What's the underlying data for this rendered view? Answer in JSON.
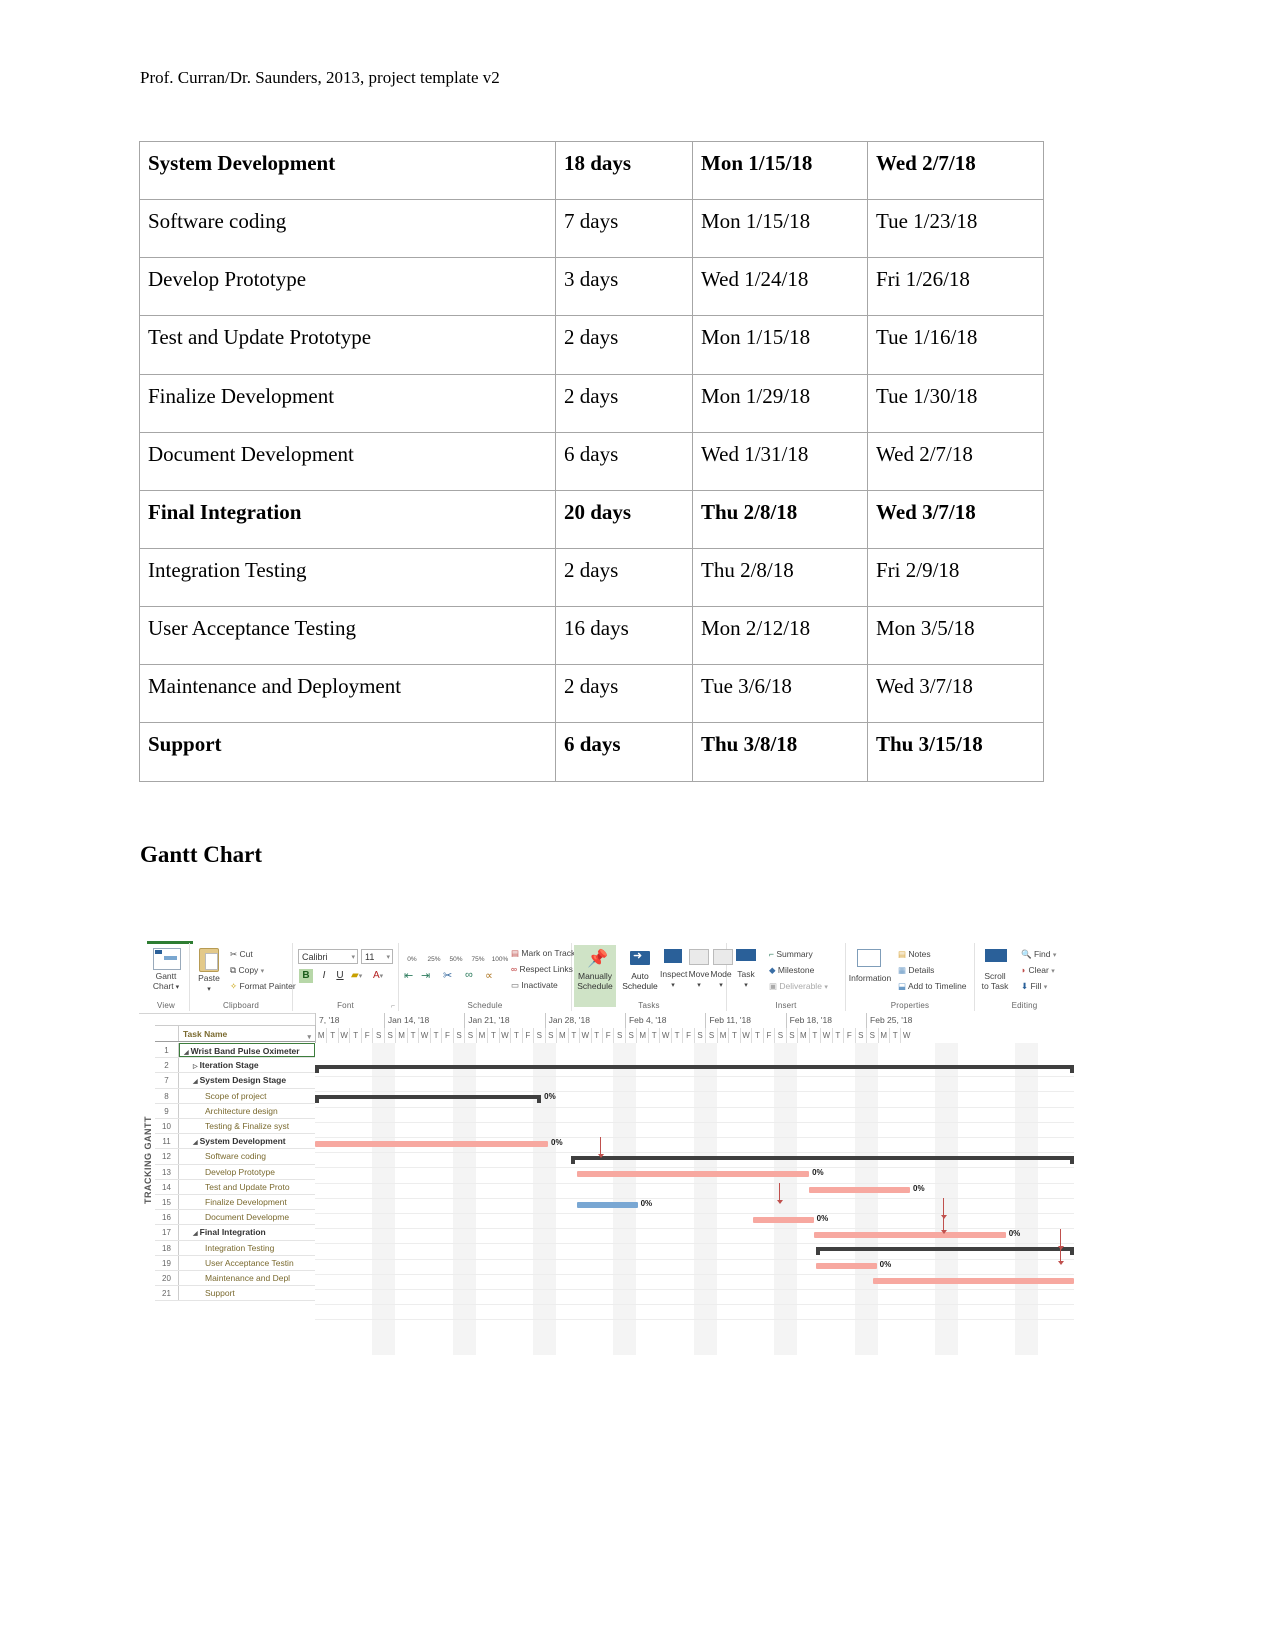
{
  "document": {
    "header_note": "Prof. Curran/Dr. Saunders, 2013, project template v2",
    "gantt_heading": "Gantt Chart"
  },
  "schedule_table": {
    "columns": [
      "Task Name",
      "Duration",
      "Start",
      "Finish"
    ],
    "rows": [
      {
        "name": "System Development",
        "duration": "18 days",
        "start": "Mon 1/15/18",
        "finish": "Wed 2/7/18",
        "level": "summary"
      },
      {
        "name": "Software coding",
        "duration": "7 days",
        "start": "Mon 1/15/18",
        "finish": "Tue 1/23/18",
        "level": "task"
      },
      {
        "name": "Develop Prototype",
        "duration": "3 days",
        "start": "Wed 1/24/18",
        "finish": "Fri 1/26/18",
        "level": "task"
      },
      {
        "name": "Test and Update Prototype",
        "duration": "2 days",
        "start": "Mon 1/15/18",
        "finish": "Tue 1/16/18",
        "level": "task"
      },
      {
        "name": "Finalize Development",
        "duration": "2 days",
        "start": "Mon 1/29/18",
        "finish": "Tue 1/30/18",
        "level": "task"
      },
      {
        "name": "Document Development",
        "duration": "6 days",
        "start": "Wed 1/31/18",
        "finish": "Wed 2/7/18",
        "level": "task"
      },
      {
        "name": "Final Integration",
        "duration": "20 days",
        "start": "Thu 2/8/18",
        "finish": "Wed 3/7/18",
        "level": "summary"
      },
      {
        "name": "Integration Testing",
        "duration": "2 days",
        "start": "Thu 2/8/18",
        "finish": "Fri 2/9/18",
        "level": "task"
      },
      {
        "name": "User Acceptance Testing",
        "duration": "16 days",
        "start": "Mon 2/12/18",
        "finish": "Mon 3/5/18",
        "level": "task"
      },
      {
        "name": "Maintenance and Deployment",
        "duration": "2 days",
        "start": "Tue 3/6/18",
        "finish": "Wed 3/7/18",
        "level": "task"
      },
      {
        "name": "Support",
        "duration": "6 days",
        "start": "Thu 3/8/18",
        "finish": "Thu 3/15/18",
        "level": "summary"
      }
    ]
  },
  "msproject": {
    "ribbon": {
      "groups": [
        {
          "label": "View",
          "items": [
            "Gantt Chart"
          ]
        },
        {
          "label": "Clipboard",
          "items": [
            "Paste",
            "Cut",
            "Copy",
            "Format Painter"
          ]
        },
        {
          "label": "Font",
          "items": [
            "Calibri",
            "11",
            "B",
            "I",
            "U"
          ]
        },
        {
          "label": "Schedule",
          "items": [
            "0%",
            "25%",
            "50%",
            "75%",
            "100%",
            "Mark on Track",
            "Respect Links",
            "Inactivate"
          ]
        },
        {
          "label": "Tasks",
          "items": [
            "Manually Schedule",
            "Auto Schedule",
            "Inspect",
            "Move",
            "Mode"
          ]
        },
        {
          "label": "Insert",
          "items": [
            "Task",
            "Summary",
            "Milestone",
            "Deliverable"
          ]
        },
        {
          "label": "Properties",
          "items": [
            "Information",
            "Notes",
            "Details",
            "Add to Timeline"
          ]
        },
        {
          "label": "Editing",
          "items": [
            "Scroll to Task",
            "Find",
            "Clear",
            "Fill"
          ]
        }
      ],
      "view_label_1": "Gantt",
      "view_label_2": "Chart",
      "paste_label": "Paste",
      "cut_label": "Cut",
      "copy_label": "Copy",
      "format_painter_label": "Format Painter",
      "font_name": "Calibri",
      "font_size": "11",
      "bold_label": "B",
      "italic_label": "I",
      "underline_label": "U",
      "pct_0": "0%",
      "pct_25": "25%",
      "pct_50": "50%",
      "pct_75": "75%",
      "pct_100": "100%",
      "mark_on_track": "Mark on Track",
      "respect_links": "Respect Links",
      "inactivate": "Inactivate",
      "manually_1": "Manually",
      "manually_2": "Schedule",
      "auto_1": "Auto",
      "auto_2": "Schedule",
      "inspect": "Inspect",
      "move": "Move",
      "mode": "Mode",
      "task": "Task",
      "summary": "Summary",
      "milestone": "Milestone",
      "deliverable": "Deliverable",
      "information": "Information",
      "notes": "Notes",
      "details": "Details",
      "add_to_timeline": "Add to Timeline",
      "scroll_1": "Scroll",
      "scroll_2": "to Task",
      "find": "Find",
      "clear": "Clear",
      "fill": "Fill"
    },
    "view_side_label": "TRACKING GANTT",
    "grid": {
      "column_header": "Task Name",
      "rows": [
        {
          "id": "1",
          "name": "Wrist Band Pulse Oximeter",
          "level": 0,
          "expander": "collapse",
          "selected": true
        },
        {
          "id": "2",
          "name": "Iteration Stage",
          "level": 1,
          "expander": "expand",
          "selected": false
        },
        {
          "id": "7",
          "name": "System Design Stage",
          "level": 1,
          "expander": "collapse",
          "selected": false
        },
        {
          "id": "8",
          "name": "Scope of project",
          "level": 2,
          "expander": "none",
          "selected": false
        },
        {
          "id": "9",
          "name": "Architecture design",
          "level": 2,
          "expander": "none",
          "selected": false
        },
        {
          "id": "10",
          "name": "Testing & Finalize syst",
          "level": 2,
          "expander": "none",
          "selected": false
        },
        {
          "id": "11",
          "name": "System Development",
          "level": 1,
          "expander": "collapse",
          "selected": false
        },
        {
          "id": "12",
          "name": "Software coding",
          "level": 2,
          "expander": "none",
          "selected": false
        },
        {
          "id": "13",
          "name": "Develop Prototype",
          "level": 2,
          "expander": "none",
          "selected": false
        },
        {
          "id": "14",
          "name": "Test and Update Proto",
          "level": 2,
          "expander": "none",
          "selected": false
        },
        {
          "id": "15",
          "name": "Finalize Development",
          "level": 2,
          "expander": "none",
          "selected": false
        },
        {
          "id": "16",
          "name": "Document Developme",
          "level": 2,
          "expander": "none",
          "selected": false
        },
        {
          "id": "17",
          "name": "Final Integration",
          "level": 1,
          "expander": "collapse",
          "selected": false
        },
        {
          "id": "18",
          "name": "Integration Testing",
          "level": 2,
          "expander": "none",
          "selected": false
        },
        {
          "id": "19",
          "name": "User Acceptance Testin",
          "level": 2,
          "expander": "none",
          "selected": false
        },
        {
          "id": "20",
          "name": "Maintenance and Depl",
          "level": 2,
          "expander": "none",
          "selected": false
        },
        {
          "id": "21",
          "name": "Support",
          "level": 2,
          "expander": "none",
          "selected": false
        }
      ]
    },
    "timeline": {
      "weeks": [
        "7, '18",
        "Jan 14, '18",
        "Jan 21, '18",
        "Jan 28, '18",
        "Feb 4, '18",
        "Feb 11, '18",
        "Feb 18, '18",
        "Feb 25, '18"
      ],
      "first_week_days": [
        "M",
        "T",
        "W",
        "T",
        "F",
        "S"
      ],
      "week_days": [
        "S",
        "M",
        "T",
        "W",
        "T",
        "F",
        "S"
      ],
      "last_week_days": [
        "S",
        "M",
        "T",
        "W"
      ]
    },
    "chart_data": {
      "type": "bar",
      "title": "Tracking Gantt",
      "xlabel": "",
      "ylabel": "",
      "categories": [
        "Wrist Band Pulse Oximeter",
        "Iteration Stage",
        "System Design Stage",
        "Scope of project",
        "Architecture design",
        "Testing & Finalize syst",
        "System Development",
        "Software coding",
        "Develop Prototype",
        "Test and Update Proto",
        "Finalize Development",
        "Document Developme",
        "Final Integration",
        "Integration Testing",
        "User Acceptance Testin",
        "Maintenance and Depl",
        "Support"
      ],
      "bars": [
        {
          "row": 0,
          "kind": "summary",
          "left_pct": 0.0,
          "width_pct": 100.0,
          "label": ""
        },
        {
          "row": 2,
          "kind": "summary",
          "left_pct": 0.0,
          "width_pct": 29.8,
          "label": "0%"
        },
        {
          "row": 5,
          "kind": "task",
          "left_pct": 0.0,
          "width_pct": 30.7,
          "label": "0%"
        },
        {
          "row": 6,
          "kind": "summary",
          "left_pct": 33.7,
          "width_pct": 66.3,
          "label": "0%"
        },
        {
          "row": 7,
          "kind": "task",
          "left_pct": 34.5,
          "width_pct": 30.6,
          "label": "0%"
        },
        {
          "row": 8,
          "kind": "task",
          "left_pct": 65.1,
          "width_pct": 13.3,
          "label": "0%"
        },
        {
          "row": 9,
          "kind": "manual",
          "left_pct": 34.5,
          "width_pct": 8.0,
          "label": "0%"
        },
        {
          "row": 10,
          "kind": "task",
          "left_pct": 57.7,
          "width_pct": 8.0,
          "label": "0%"
        },
        {
          "row": 11,
          "kind": "task",
          "left_pct": 65.7,
          "width_pct": 25.3,
          "label": "0%"
        },
        {
          "row": 12,
          "kind": "summary",
          "left_pct": 66.0,
          "width_pct": 34.0,
          "label": ""
        },
        {
          "row": 13,
          "kind": "task",
          "left_pct": 66.0,
          "width_pct": 8.0,
          "label": "0%"
        },
        {
          "row": 14,
          "kind": "task",
          "left_pct": 73.5,
          "width_pct": 26.5,
          "label": ""
        }
      ],
      "progress_label": "0%",
      "axis_weeks": [
        "7, '18",
        "Jan 14, '18",
        "Jan 21, '18",
        "Jan 28, '18",
        "Feb 4, '18",
        "Feb 11, '18",
        "Feb 18, '18",
        "Feb 25, '18"
      ],
      "grid": true,
      "legend": []
    },
    "colors": {
      "summary_bar": "#3f3f3f",
      "task_bar": "#f7a8a0",
      "manual_bar": "#79a7d3",
      "link": "#c0504d",
      "tab_accent": "#2e7d32",
      "grid_text": "#7a6a2f"
    }
  }
}
